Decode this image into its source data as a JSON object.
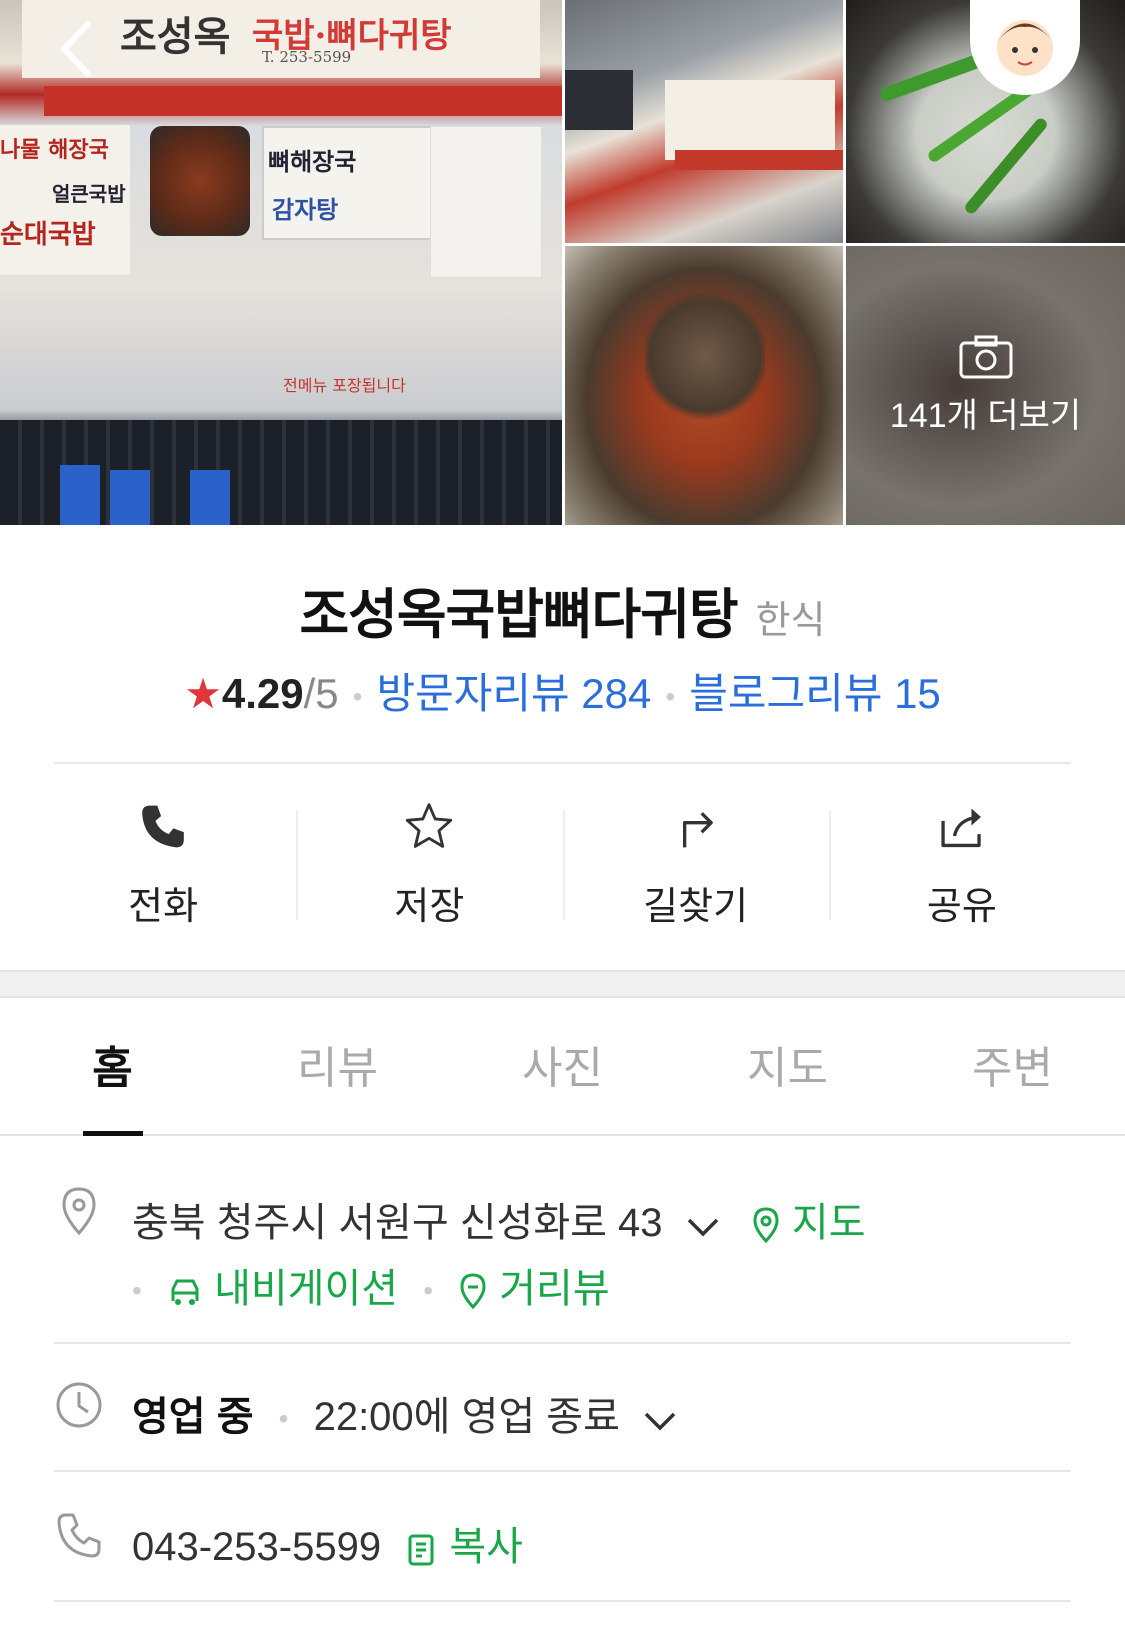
{
  "gallery": {
    "more_label": "141개 더보기",
    "sign_main": "조성옥",
    "sign_sub": "국밥·뼈다귀탕",
    "sign_phone": "T. 253-5599",
    "sign_menu1": "뼈해장국",
    "sign_menu2": "감자탕",
    "sign_left1": "나물 해장국",
    "sign_left2": "얼큰국밥",
    "sign_left3": "순대국밥",
    "sign_banner": "전메뉴 포장됩니다"
  },
  "place": {
    "name": "조성옥국밥뼈다귀탕",
    "category": "한식",
    "rating": "4.29",
    "rating_max": "/5",
    "visitor_reviews": "방문자리뷰 284",
    "blog_reviews": "블로그리뷰 15"
  },
  "actions": [
    {
      "label": "전화",
      "icon": "phone-icon"
    },
    {
      "label": "저장",
      "icon": "star-icon"
    },
    {
      "label": "길찾기",
      "icon": "directions-icon"
    },
    {
      "label": "공유",
      "icon": "share-icon"
    }
  ],
  "tabs": [
    "홈",
    "리뷰",
    "사진",
    "지도",
    "주변"
  ],
  "address": {
    "text": "충북 청주시 서원구 신성화로 43",
    "map_link": "지도",
    "navigation_link": "내비게이션",
    "street_view_link": "거리뷰"
  },
  "hours": {
    "status": "영업 중",
    "detail": "22:00에 영업 종료"
  },
  "phone": {
    "number": "043-253-5599",
    "copy_label": "복사"
  },
  "colors": {
    "star": "#e2353a",
    "link_blue": "#2a6edb",
    "link_green": "#1aa74a"
  }
}
